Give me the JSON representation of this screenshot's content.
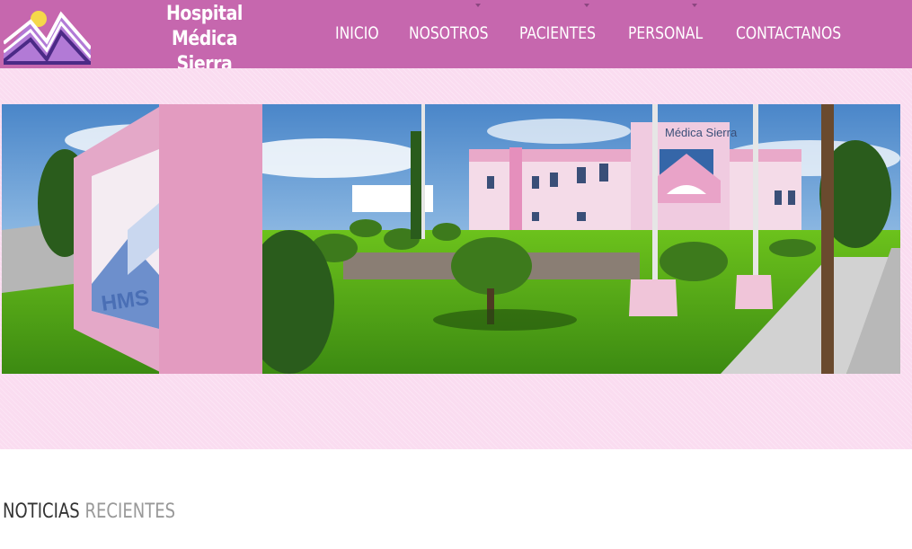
{
  "brand": {
    "line1": "Hospital",
    "line2": "Médica Sierra"
  },
  "nav": {
    "items": [
      {
        "label": "INICIO",
        "has_dropdown": false
      },
      {
        "label": "NOSOTROS",
        "has_dropdown": true
      },
      {
        "label": "PACIENTES",
        "has_dropdown": true
      },
      {
        "label": "PERSONAL",
        "has_dropdown": true
      },
      {
        "label": "CONTACTANOS",
        "has_dropdown": false
      }
    ]
  },
  "hero": {
    "sign_text": "HMS",
    "building_sign": "Médica Sierra"
  },
  "news": {
    "title_part1": "NOTICIAS",
    "title_part2": "RECIENTES"
  },
  "colors": {
    "header": "#c667ae",
    "band": "#fadcf0",
    "brand_text": "#ffffff",
    "title_dark": "#333333",
    "title_light": "#999999"
  },
  "icons": [
    "logo-mountain-sun-icon",
    "caret-down-icon"
  ]
}
